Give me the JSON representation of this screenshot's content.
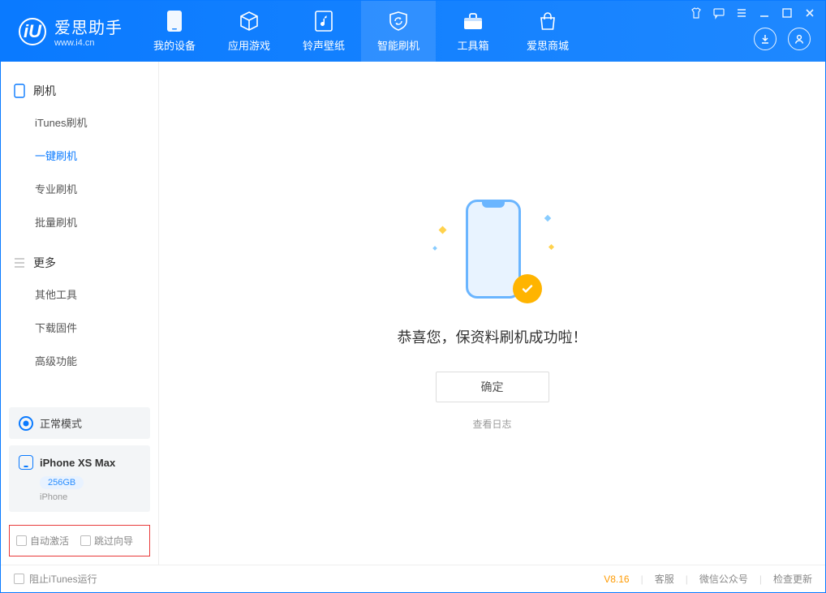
{
  "brand": {
    "name": "爱思助手",
    "url": "www.i4.cn"
  },
  "nav": {
    "items": [
      {
        "label": "我的设备"
      },
      {
        "label": "应用游戏"
      },
      {
        "label": "铃声壁纸"
      },
      {
        "label": "智能刷机"
      },
      {
        "label": "工具箱"
      },
      {
        "label": "爱思商城"
      }
    ]
  },
  "sidebar": {
    "group1": {
      "hd": "刷机",
      "items": [
        "iTunes刷机",
        "一键刷机",
        "专业刷机",
        "批量刷机"
      ]
    },
    "group2": {
      "hd": "更多",
      "items": [
        "其他工具",
        "下载固件",
        "高级功能"
      ]
    },
    "status": "正常模式",
    "device": {
      "name": "iPhone XS Max",
      "badge": "256GB",
      "sub": "iPhone"
    },
    "opt1": "自动激活",
    "opt2": "跳过向导"
  },
  "main": {
    "success": "恭喜您，保资料刷机成功啦！",
    "ok": "确定",
    "log": "查看日志"
  },
  "statusbar": {
    "block_itunes": "阻止iTunes运行",
    "version": "V8.16",
    "support": "客服",
    "wechat": "微信公众号",
    "update": "检查更新"
  }
}
